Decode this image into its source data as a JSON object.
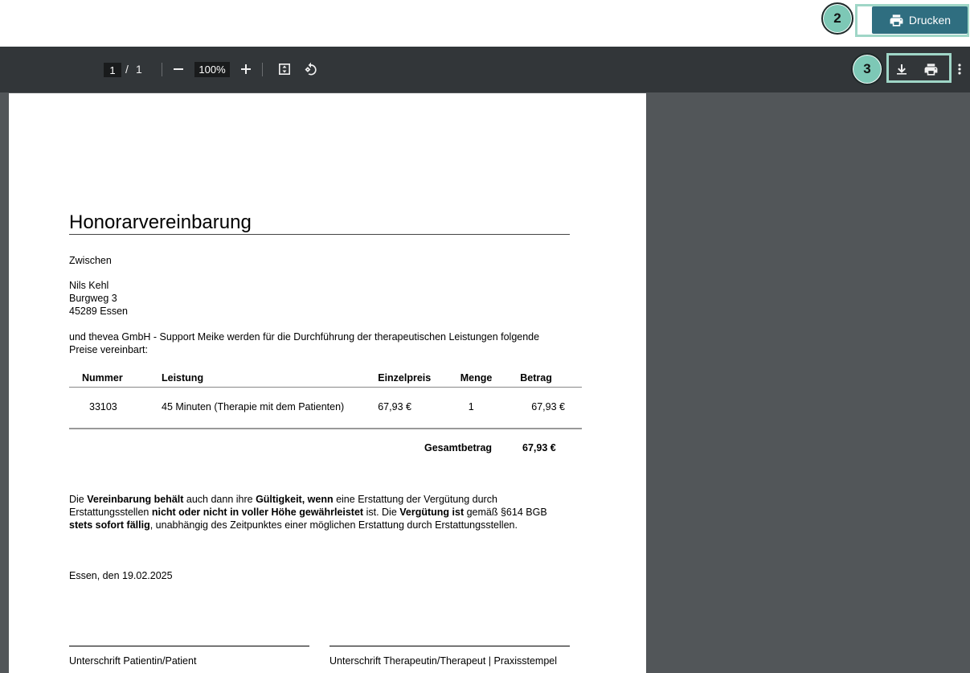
{
  "app": {
    "step_badge_print": "2",
    "print_button_label": "Drucken"
  },
  "viewer": {
    "current_page": "1",
    "page_separator": "/",
    "total_pages": "1",
    "zoom": "100%",
    "step_badge_tools": "3"
  },
  "document": {
    "title": "Honorarvereinbarung",
    "intro": "Zwischen",
    "patient": {
      "name": "Nils Kehl",
      "street": "Burgweg 3",
      "city": "45289 Essen"
    },
    "agreement_line1": "und thevea GmbH - Support Meike werden für die Durchführung der therapeutischen Leistungen folgende",
    "agreement_line2": "Preise vereinbart:",
    "table": {
      "headers": [
        "Nummer",
        "Leistung",
        "Einzelpreis",
        "Menge",
        "Betrag"
      ],
      "rows": [
        [
          "33103",
          "45 Minuten (Therapie mit dem Patienten)",
          "67,93 €",
          "1",
          "67,93 €"
        ]
      ],
      "total_label": "Gesamtbetrag",
      "total_value": "67,93 €"
    },
    "terms": {
      "l1_a": "Die ",
      "l1_b": "Vereinbarung behält",
      "l1_c": " auch dann ihre ",
      "l1_d": "Gültigkeit, wenn",
      "l1_e": " eine Erstattung der Vergütung durch",
      "l2_a": "Erstattungsstellen ",
      "l2_b": "nicht oder nicht in voller Höhe gewährleistet",
      "l2_c": " ist. Die ",
      "l2_d": "Vergütung ist",
      "l2_e": " gemäß §614 BGB",
      "l3_a": "stets sofort fällig",
      "l3_b": ", unabhängig des Zeitpunktes einer möglichen Erstattung durch Erstattungsstellen."
    },
    "place_date": "Essen, den 19.02.2025",
    "signature_patient": "Unterschrift Patientin/Patient",
    "signature_therapist": "Unterschrift Therapeutin/Therapeut | Praxisstempel"
  },
  "colors": {
    "print_button": "#2f6e80",
    "badge": "#7dc8b6",
    "highlight": "#9fd6c7",
    "toolbar": "#323639",
    "viewer_bg": "#525659"
  }
}
